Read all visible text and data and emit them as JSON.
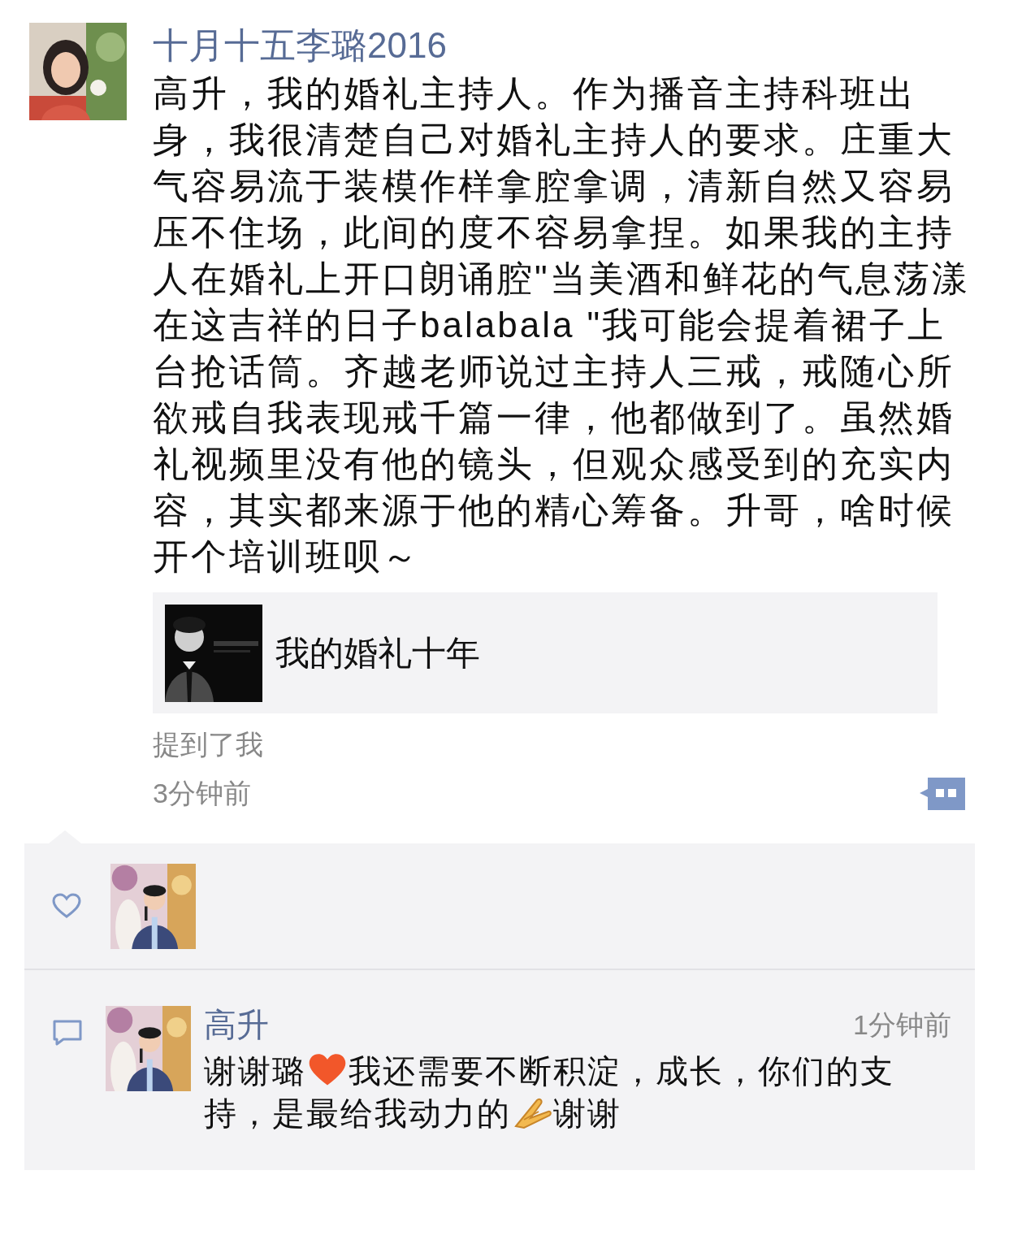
{
  "post": {
    "author": "十月十五李璐2016",
    "text": "高升，我的婚礼主持人。作为播音主持科班出身，我很清楚自己对婚礼主持人的要求。庄重大气容易流于装模作样拿腔拿调，清新自然又容易压不住场，此间的度不容易拿捏。如果我的主持人在婚礼上开口朗诵腔\"当美酒和鲜花的气息荡漾在这吉祥的日子balabala \"我可能会提着裙子上台抢话筒。齐越老师说过主持人三戒，戒随心所欲戒自我表现戒千篇一律，他都做到了。虽然婚礼视频里没有他的镜头，但观众感受到的充实内容，其实都来源于他的精心筹备。升哥，啥时候开个培训班呗～",
    "link": {
      "title": "我的婚礼十年"
    },
    "mention": "提到了我",
    "time": "3分钟前"
  },
  "comments": [
    {
      "author": "高升",
      "time": "1分钟前",
      "parts": [
        {
          "kind": "text",
          "text": "谢谢璐"
        },
        {
          "kind": "heart"
        },
        {
          "kind": "text",
          "text": "我还需要不断积淀，成长，你们的支持，是最给我动力的"
        },
        {
          "kind": "hands"
        },
        {
          "kind": "text",
          "text": "谢谢"
        }
      ]
    }
  ]
}
